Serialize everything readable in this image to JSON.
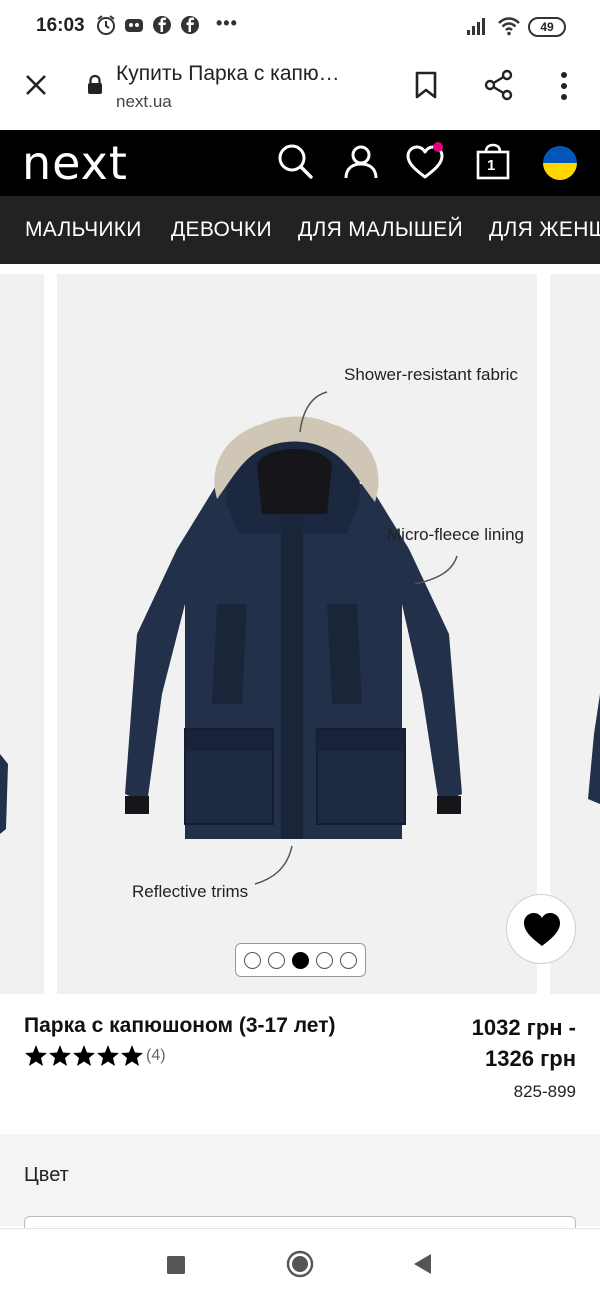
{
  "status_bar": {
    "time": "16:03",
    "more_dots": "•••",
    "battery": "49",
    "icons": [
      "alarm-icon",
      "game-icon",
      "facebook-icon",
      "facebook-icon",
      "signal-icon",
      "wifi-icon",
      "battery-icon"
    ]
  },
  "browser": {
    "page_title": "Купить Парка с капю…",
    "url": "next.ua",
    "icons": [
      "close-icon",
      "lock-icon",
      "bookmark-icon",
      "share-icon",
      "more-vert-icon"
    ]
  },
  "site_header": {
    "logo": "next",
    "bag_count": "1",
    "icons": [
      "search-icon",
      "account-icon",
      "favourites-icon",
      "bag-icon",
      "ukraine-flag-icon"
    ],
    "colors": {
      "background": "#000000",
      "favourites_dot": "#e5007e",
      "flag_blue": "#0057b7",
      "flag_yellow": "#ffd700"
    }
  },
  "categories": [
    "МАЛЬЧИКИ",
    "ДЕВОЧКИ",
    "ДЛЯ МАЛЫШЕЙ",
    "ДЛЯ ЖЕНЩИН"
  ],
  "gallery": {
    "annotations": {
      "top": "Shower-resistant fabric",
      "middle": "Micro-fleece lining",
      "bottom": "Reflective trims"
    },
    "slide_count": 5,
    "active_slide": 3,
    "colors": {
      "jacket": "#23304a",
      "fur": "#cfc6b5"
    },
    "icons": [
      "heart-icon"
    ]
  },
  "product": {
    "name": "Парка с капюшоном (3-17 лет)",
    "rating": 5,
    "review_count": "(4)",
    "price_line1": "1032 грн -",
    "price_line2": "1326 грн",
    "code": "825-899"
  },
  "color_section": {
    "label": "Цвет"
  },
  "android_nav": {
    "icons": [
      "recents-icon",
      "home-icon",
      "back-icon"
    ]
  }
}
